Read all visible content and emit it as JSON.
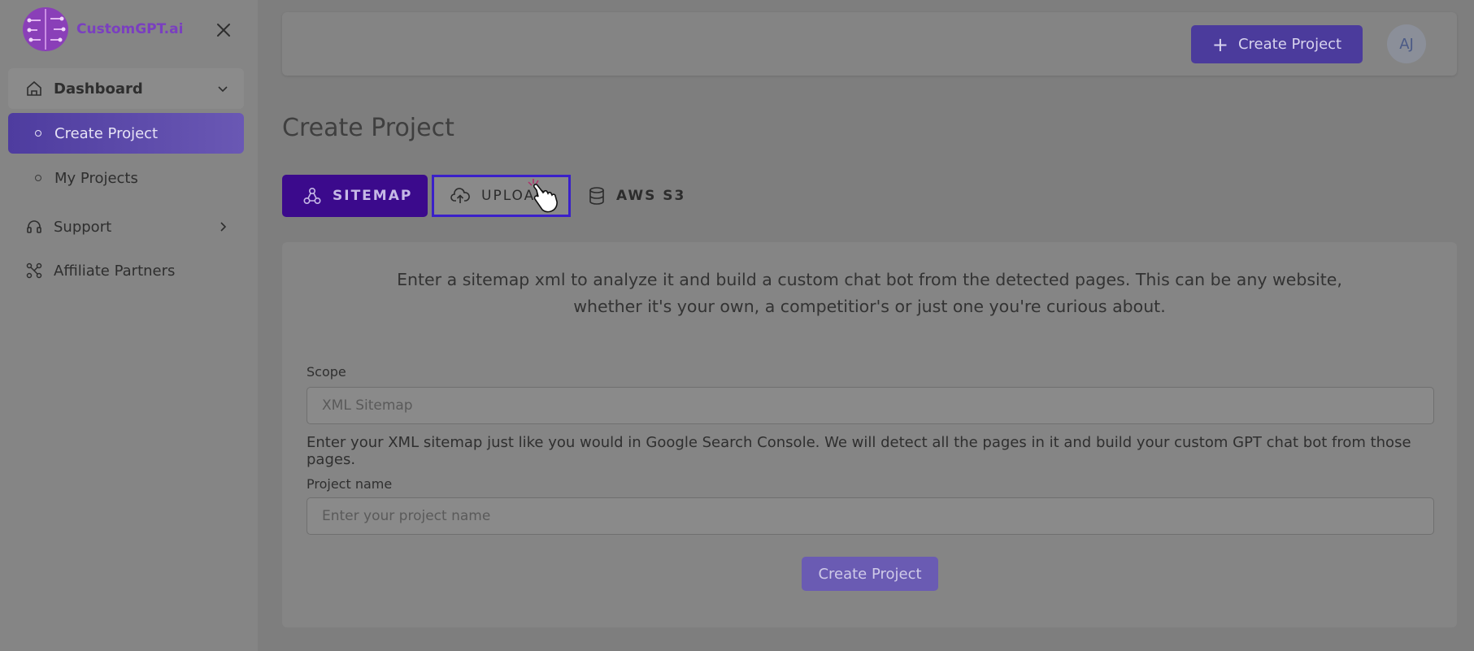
{
  "brand": {
    "name": "CustomGPT.ai",
    "color": "#7a3fc0"
  },
  "sidebar": {
    "items": [
      {
        "label": "Dashboard",
        "icon": "home-icon"
      },
      {
        "label": "Create Project",
        "icon": "circle-icon",
        "active": true
      },
      {
        "label": "My Projects",
        "icon": "circle-icon"
      },
      {
        "label": "Support",
        "icon": "headset-icon"
      },
      {
        "label": "Affiliate Partners",
        "icon": "network-icon"
      }
    ]
  },
  "header": {
    "create_button_label": "Create Project",
    "avatar_initials": "AJ"
  },
  "main": {
    "title": "Create Project",
    "tabs": [
      {
        "label": "SITEMAP",
        "icon": "sitemap-icon",
        "active": true
      },
      {
        "label": "UPLOAD",
        "icon": "cloud-upload-icon"
      },
      {
        "label": "AWS S3",
        "icon": "database-icon"
      }
    ],
    "description_line1": "Enter a sitemap xml to analyze it and build a custom chat bot from the detected pages. This can be any website,",
    "description_line2": "whether it's your own, a competitior's or just one you're curious about.",
    "form": {
      "scope_label": "Scope",
      "scope_placeholder": "XML Sitemap",
      "scope_help": "Enter your XML sitemap just like you would in Google Search Console. We will detect all the pages in it and build your custom GPT chat bot from those pages.",
      "project_name_label": "Project name",
      "project_name_placeholder": "Enter your project name",
      "submit_label": "Create Project"
    }
  },
  "colors": {
    "accent": "#4b3b9c",
    "tab_active": "#3b0a8c",
    "focus_border": "#3a20c9"
  }
}
